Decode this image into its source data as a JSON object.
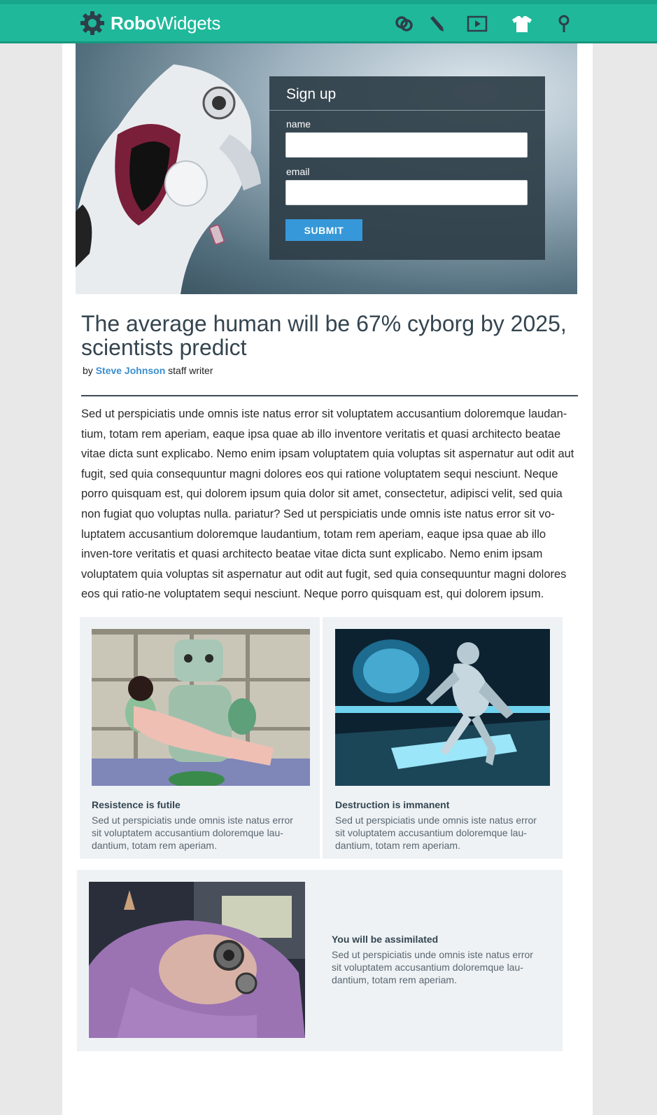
{
  "brand": {
    "name_bold": "Robo",
    "name_light": "Widgets",
    "primary_color": "#1fb89b",
    "accent_color": "#3698d8"
  },
  "nav": {
    "icons": [
      "link-icon",
      "pencil-icon",
      "video-icon",
      "tshirt-icon",
      "location-pin-icon"
    ]
  },
  "signup": {
    "title": "Sign up",
    "name_label": "name",
    "name_value": "",
    "email_label": "email",
    "email_value": "",
    "submit_label": "SUBMIT"
  },
  "article": {
    "headline": "The average human will be 67% cyborg by 2025, scientists predict",
    "by_prefix": "by",
    "author": "Steve Johnson",
    "author_role": "staff writer",
    "body": "Sed ut perspiciatis unde omnis iste natus error sit voluptatem accusantium doloremque laudan-tium, totam rem aperiam, eaque ipsa quae ab illo inventore veritatis et quasi architecto beatae vitae dicta sunt explicabo. Nemo enim ipsam voluptatem quia voluptas sit aspernatur aut odit aut fugit, sed quia consequuntur magni dolores eos qui ratione voluptatem sequi nesciunt. Neque porro quisquam est, qui dolorem ipsum quia dolor sit amet, consectetur, adipisci velit, sed quia non fugiat quo voluptas nulla. pariatur? Sed ut perspiciatis unde omnis iste natus error sit vo-luptatem accusantium doloremque laudantium, totam rem aperiam, eaque ipsa quae ab illo inven-tore veritatis et quasi architecto beatae vitae dicta sunt explicabo. Nemo enim ipsam voluptatem quia voluptas sit aspernatur aut odit aut fugit, sed quia consequuntur magni dolores eos qui ratio-ne voluptatem sequi nesciunt. Neque porro quisquam est, qui dolorem ipsum."
  },
  "cards": [
    {
      "title": "Resistence is futile",
      "text": "Sed ut perspiciatis unde omnis iste natus error sit voluptatem accusantium doloremque lau-dantium, totam rem aperiam."
    },
    {
      "title": "Destruction is immanent",
      "text": "Sed ut perspiciatis unde omnis iste natus error sit voluptatem accusantium doloremque lau-dantium, totam rem aperiam."
    },
    {
      "title": "You will be assimilated",
      "text": "Sed ut perspiciatis unde omnis iste natus error sit voluptatem accusantium doloremque lau-dantium, totam rem aperiam."
    }
  ]
}
